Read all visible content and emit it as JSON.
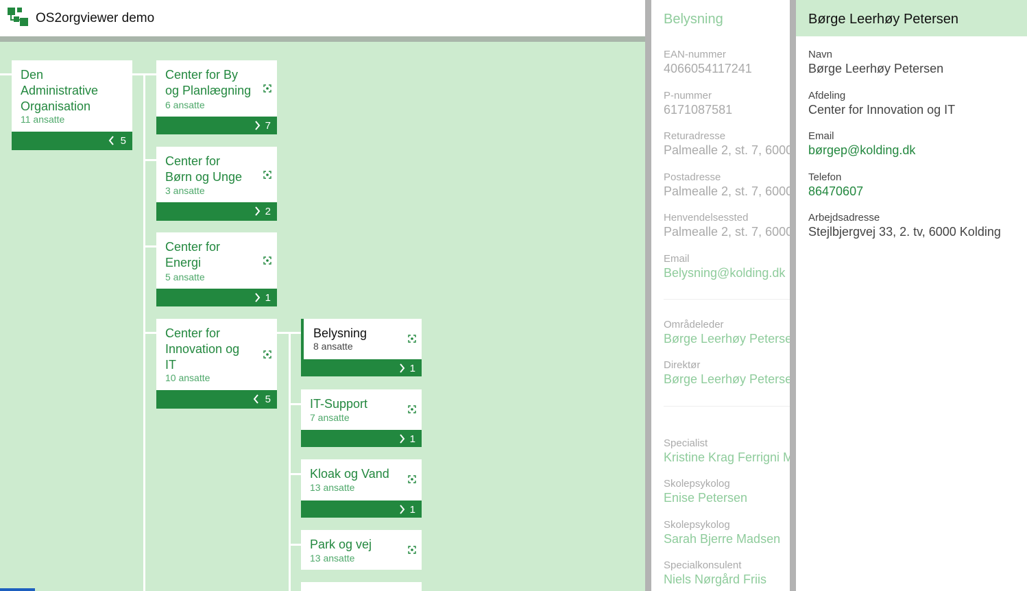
{
  "header": {
    "title": "OS2orgviewer demo",
    "logo_icon": "org-chart-icon"
  },
  "colors": {
    "accent": "#22883f",
    "tree_bg": "#cdebcf",
    "muted_link": "#8fcc9c"
  },
  "tree": {
    "root": {
      "name_l1": "Den",
      "name_l2": "Administrative",
      "name_l3": "Organisation",
      "count": "11 ansatte",
      "children": "5"
    },
    "level1": [
      {
        "name_l1": "Center for By",
        "name_l2": "og Planlægning",
        "count": "6 ansatte",
        "children": "7"
      },
      {
        "name_l1": "Center for",
        "name_l2": "Børn og Unge",
        "count": "3 ansatte",
        "children": "2"
      },
      {
        "name_l1": "Center for",
        "name_l2": "Energi",
        "count": "5 ansatte",
        "children": "1"
      },
      {
        "name_l1": "Center for",
        "name_l2": "Innovation og",
        "name_l3": "IT",
        "count": "10 ansatte",
        "children": "5"
      }
    ],
    "level2": [
      {
        "name": "Belysning",
        "count": "8 ansatte",
        "children": "1"
      },
      {
        "name": "IT-Support",
        "count": "7 ansatte",
        "children": "1"
      },
      {
        "name": "Kloak og Vand",
        "count": "13 ansatte",
        "children": "1"
      },
      {
        "name": "Park og vej",
        "count": "13 ansatte"
      }
    ]
  },
  "unit_panel": {
    "title": "Belysning",
    "fields": [
      {
        "label": "EAN-nummer",
        "value": "4066054117241"
      },
      {
        "label": "P-nummer",
        "value": "6171087581"
      },
      {
        "label": "Returadresse",
        "value": "Palmealle 2, st. 7, 6000"
      },
      {
        "label": "Postadresse",
        "value": "Palmealle 2, st. 7, 6000"
      },
      {
        "label": "Henvendelsessted",
        "value": "Palmealle 2, st. 7, 6000"
      },
      {
        "label": "Email",
        "value": "Belysning@kolding.dk"
      }
    ],
    "managers": [
      {
        "label": "Områdeleder",
        "value": "Børge Leerhøy Petersen"
      },
      {
        "label": "Direktør",
        "value": "Børge Leerhøy Petersen"
      }
    ],
    "staff": [
      {
        "label": "Specialist",
        "value": "Kristine Krag Ferrigni Ma"
      },
      {
        "label": "Skolepsykolog",
        "value": "Enise Petersen"
      },
      {
        "label": "Skolepsykolog",
        "value": "Sarah Bjerre Madsen"
      },
      {
        "label": "Specialkonsulent",
        "value": "Niels Nørgård Friis"
      }
    ]
  },
  "person_panel": {
    "title": "Børge Leerhøy Petersen",
    "fields": [
      {
        "label": "Navn",
        "value": "Børge Leerhøy Petersen"
      },
      {
        "label": "Afdeling",
        "value": "Center for Innovation og IT"
      },
      {
        "label": "Email",
        "value": "børgep@kolding.dk"
      },
      {
        "label": "Telefon",
        "value": "86470607"
      },
      {
        "label": "Arbejdsadresse",
        "value": "Stejlbjergvej 33, 2. tv, 6000 Kolding"
      }
    ]
  }
}
